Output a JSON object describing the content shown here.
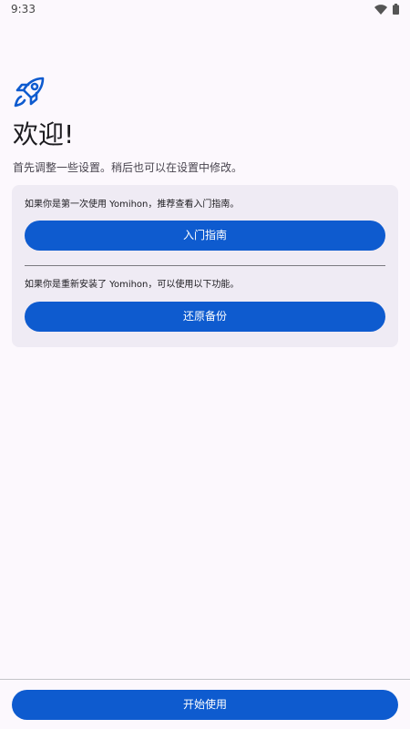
{
  "status_bar": {
    "time": "9:33",
    "icons": [
      "wifi-icon",
      "battery-icon"
    ]
  },
  "welcome": {
    "icon": "rocket-icon",
    "title": "欢迎!",
    "subtitle": "首先调整一些设置。稍后也可以在设置中修改。"
  },
  "card": {
    "first_time_text": "如果你是第一次使用 Yomihon，推荐查看入门指南。",
    "guide_button": "入门指南",
    "reinstall_text": "如果你是重新安装了 Yomihon，可以使用以下功能。",
    "restore_button": "还原备份"
  },
  "footer": {
    "start_button": "开始使用"
  },
  "colors": {
    "background": "#fcf8fd",
    "card_background": "#efebf4",
    "accent": "#0e5bcf",
    "on_accent": "#ffffff"
  }
}
